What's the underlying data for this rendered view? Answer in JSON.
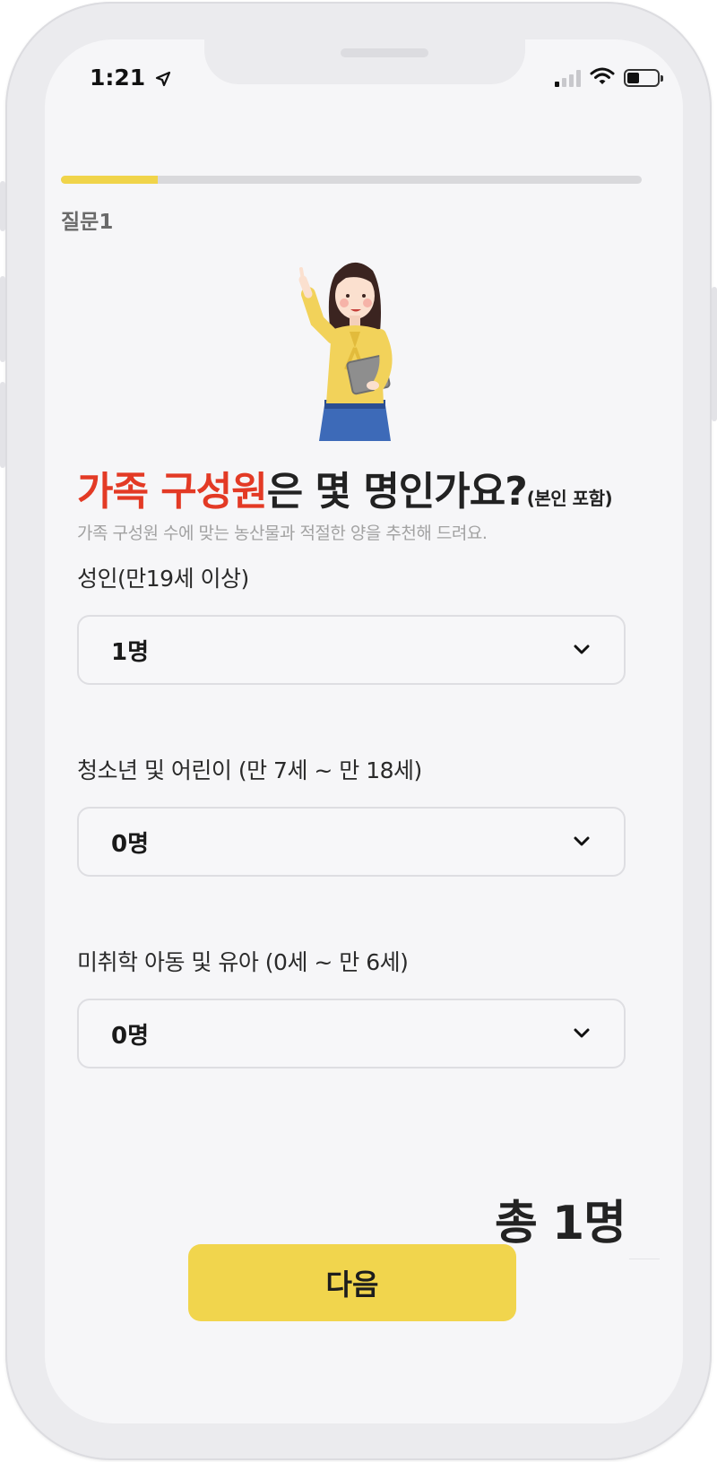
{
  "status_bar": {
    "time": "1:21",
    "location_icon": "location-arrow-icon",
    "signal_icon": "cellular-signal-icon",
    "wifi_icon": "wifi-icon",
    "battery_icon": "battery-icon"
  },
  "progress": {
    "fraction": 0.167,
    "accent_color": "#f0d44a",
    "track_color": "#d9d9dc"
  },
  "question": {
    "number_label": "질문1",
    "title_highlight": "가족 구성원",
    "title_rest": "은 몇 명인가요?",
    "title_suffix": "(본인 포함)",
    "subtitle": "가족 구성원 수에 맞는 농산물과 적절한 양을 추천해 드려요.",
    "highlight_color": "#e33a25"
  },
  "fields": [
    {
      "label": "성인(만19세 이상)",
      "value": "1명"
    },
    {
      "label": "청소년 및 어린이 (만 7세 ~ 만 18세)",
      "value": "0명"
    },
    {
      "label": "미취학 아동 및 유아 (0세 ~ 만 6세)",
      "value": "0명"
    }
  ],
  "total": {
    "text": "총 1명"
  },
  "next_button": {
    "label": "다음",
    "color": "#f1d54d"
  }
}
